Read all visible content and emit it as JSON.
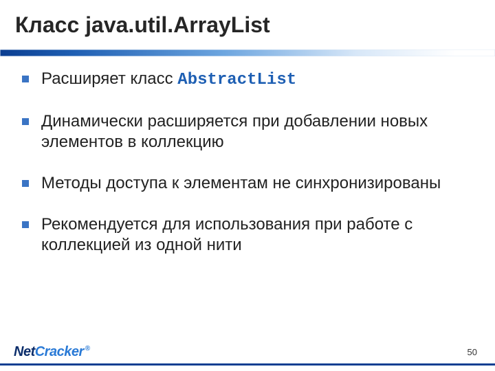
{
  "title": "Класс java.util.ArrayList",
  "bullets": [
    {
      "pre": "Расширяет класс ",
      "code": "AbstractList",
      "post": ""
    },
    {
      "pre": "Динамически расширяется при добавлении новых элементов в коллекцию",
      "code": "",
      "post": ""
    },
    {
      "pre": "Методы доступа к элементам не синхронизированы",
      "code": "",
      "post": ""
    },
    {
      "pre": "Рекомендуется  для использования при работе с коллекцией из одной нити",
      "code": "",
      "post": ""
    }
  ],
  "brand": {
    "part1": "Net",
    "part2": "Cracker",
    "reg": "®"
  },
  "page_number": "50"
}
